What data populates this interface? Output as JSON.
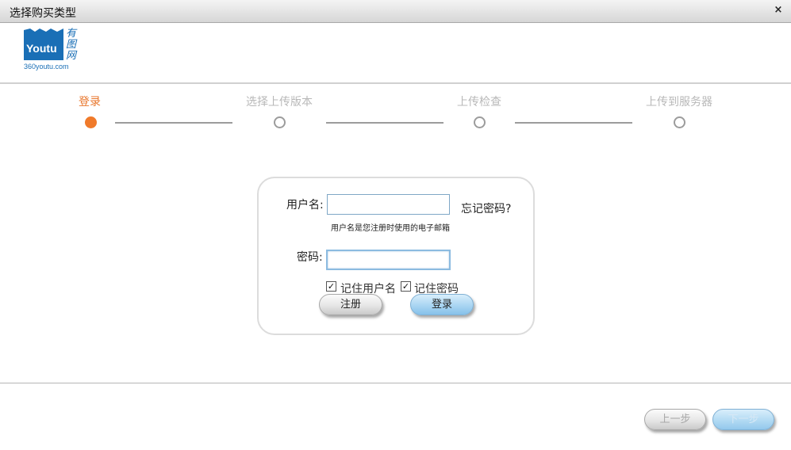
{
  "window": {
    "title": "选择购买类型",
    "close_glyph": "×"
  },
  "logo": {
    "word": "Youtu",
    "chars": "有图网",
    "url": "360youtu.com",
    "color": "#1a6fb6"
  },
  "steps": [
    {
      "label": "登录",
      "active": true
    },
    {
      "label": "选择上传版本",
      "active": false
    },
    {
      "label": "上传检查",
      "active": false
    },
    {
      "label": "上传到服务器",
      "active": false
    }
  ],
  "login": {
    "username_label": "用户名:",
    "username_value": "",
    "username_hint": "用户名是您注册时使用的电子邮箱",
    "forgot_label": "忘记密码?",
    "password_label": "密码:",
    "password_value": "",
    "remember_user_label": "记住用户名",
    "remember_user_checked": true,
    "remember_pass_label": "记住密码",
    "remember_pass_checked": true,
    "register_label": "注册",
    "login_label": "登录"
  },
  "footer": {
    "prev_label": "上一步",
    "next_label": "下一步"
  },
  "colors": {
    "accent": "#f07a2a",
    "inactive": "#b8b8b8",
    "button_blue": "#a9d5f2"
  }
}
